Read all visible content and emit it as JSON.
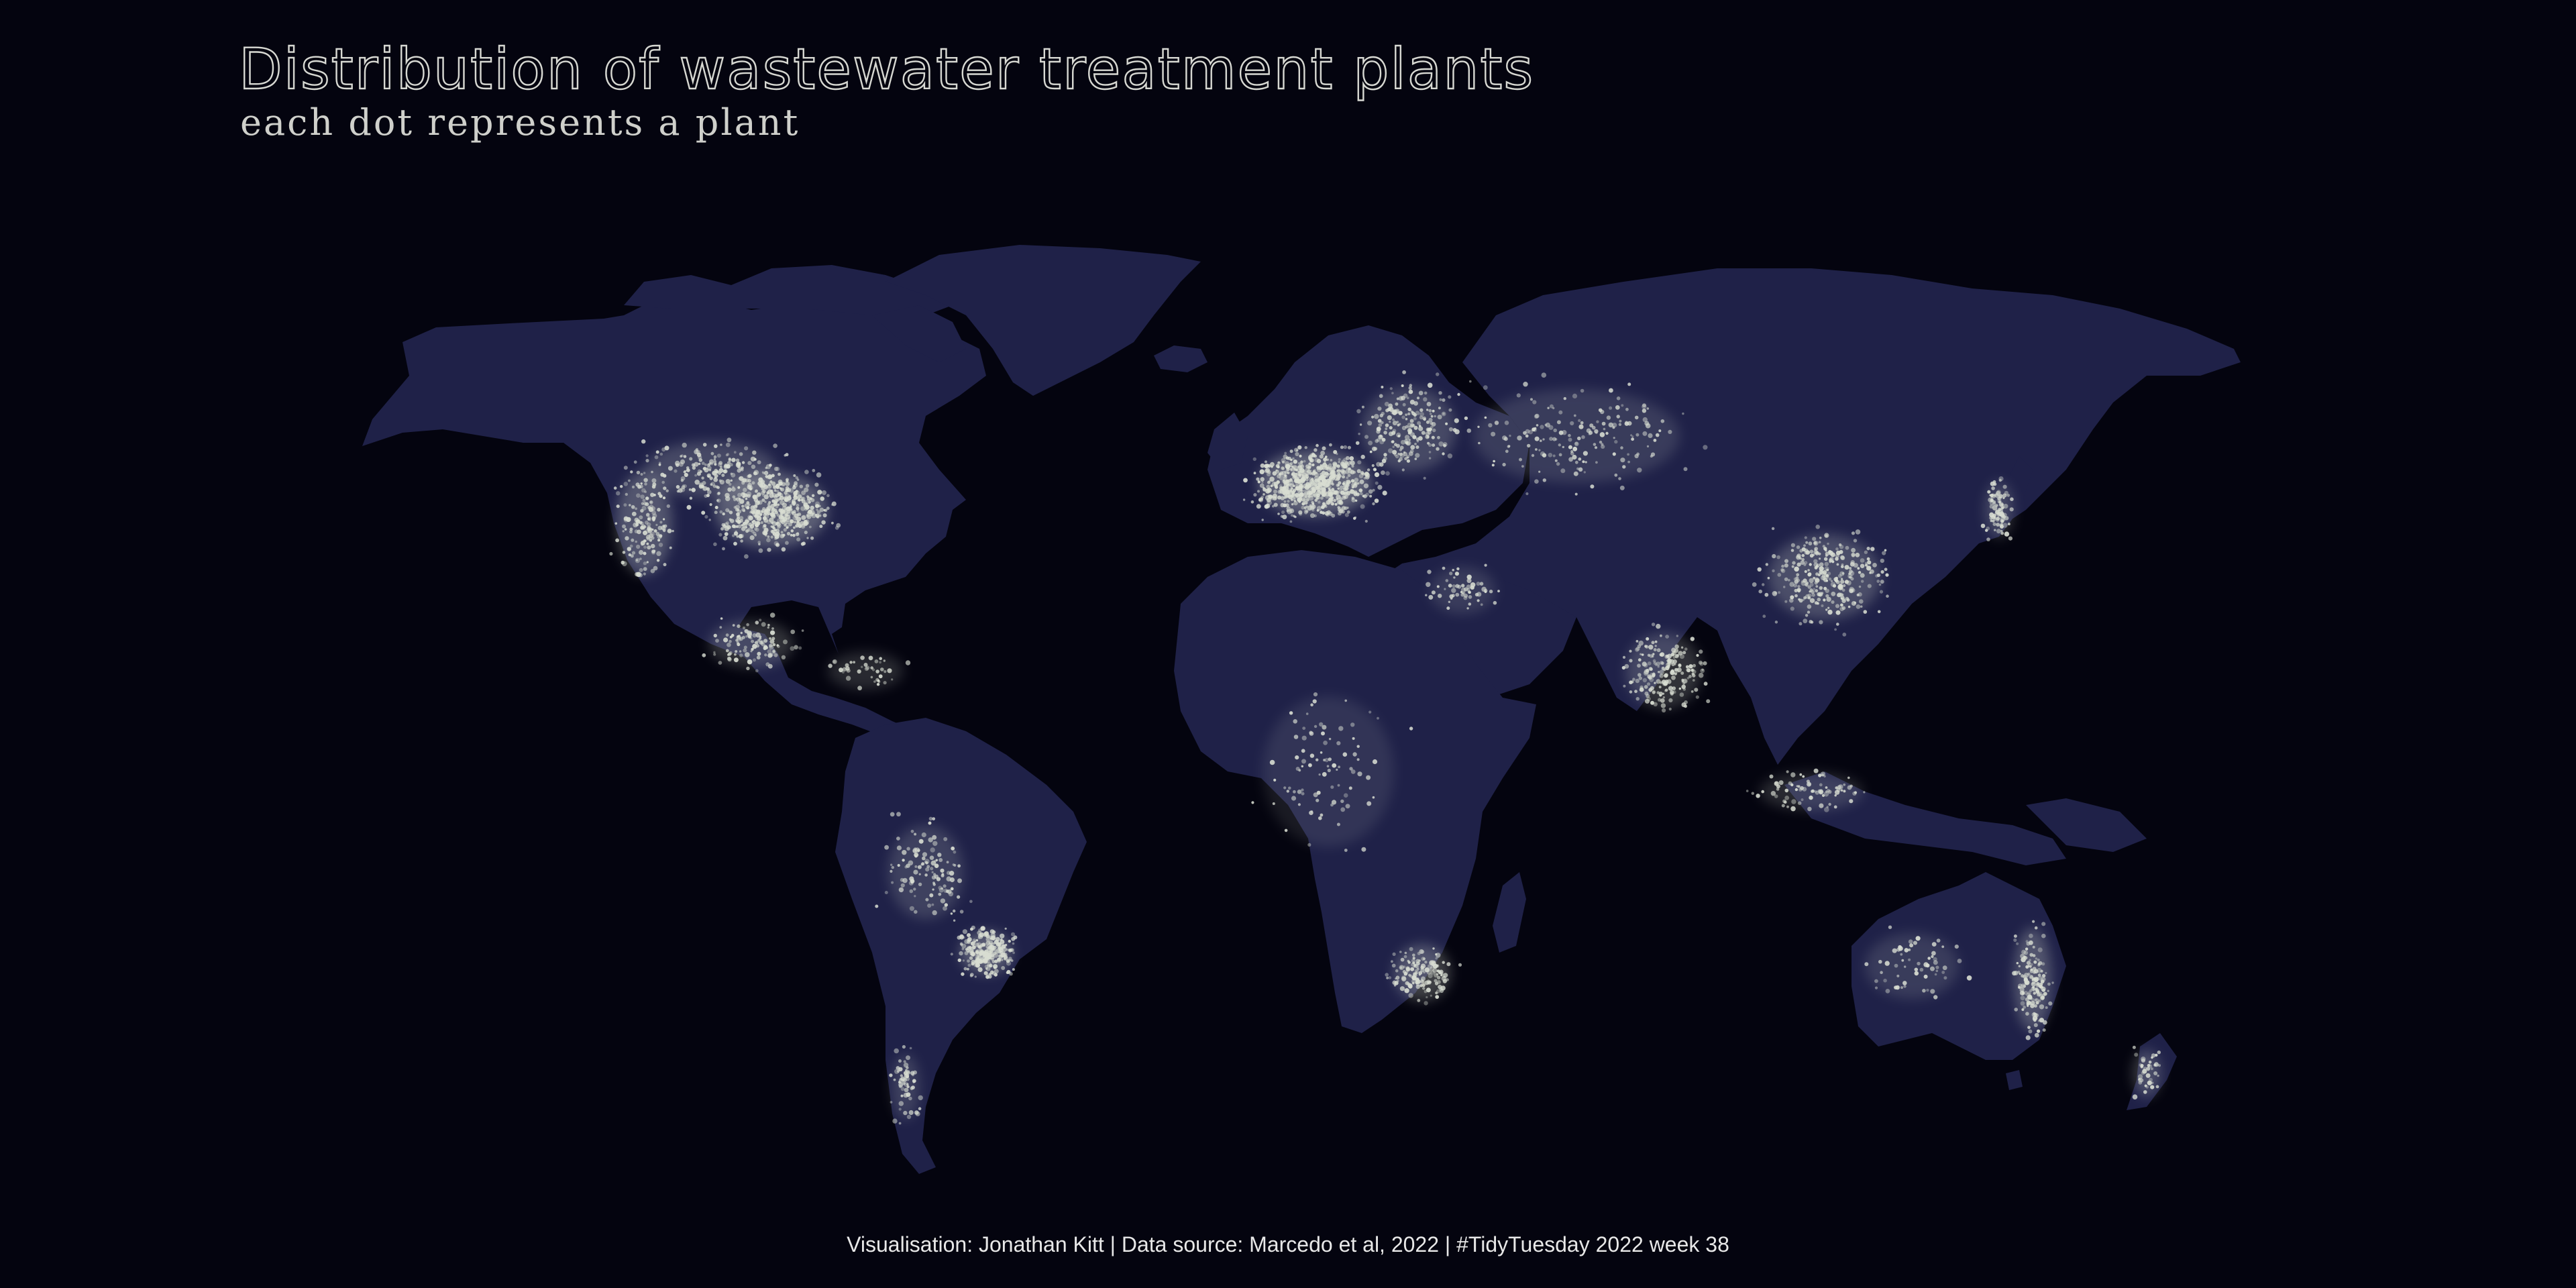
{
  "title": "Distribution of wastewater treatment plants",
  "subtitle": "each dot represents a plant",
  "caption": "Visualisation: Jonathan Kitt | Data source: Marcedo et al, 2022 | #TidyTuesday 2022 week 38",
  "colors": {
    "background": "#04040f",
    "land": "#1f2148",
    "plant_dot": "#d8ddd2",
    "title": "#d7d8d2"
  },
  "icons": [
    "plant-dot"
  ]
}
